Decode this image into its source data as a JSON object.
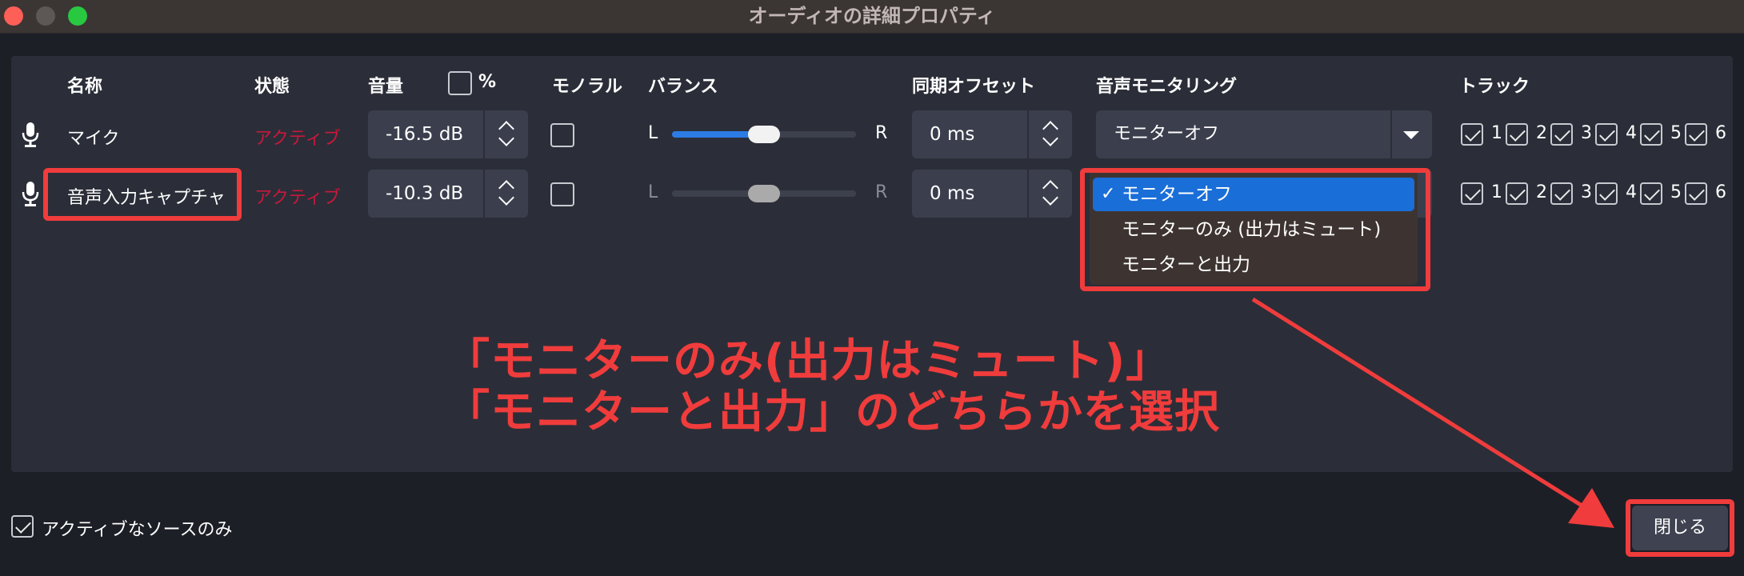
{
  "window": {
    "title": "オーディオの詳細プロパティ"
  },
  "headers": {
    "name": "名称",
    "state": "状態",
    "volume": "音量",
    "percent": "%",
    "mono": "モノラル",
    "balance": "バランス",
    "sync_offset": "同期オフセット",
    "monitoring": "音声モニタリング",
    "tracks": "トラック"
  },
  "rows": [
    {
      "name": "マイク",
      "state": "アクティブ",
      "volume": "-16.5 dB",
      "mono": false,
      "balance": {
        "left": "L",
        "right": "R",
        "value": 0.5
      },
      "offset": "0 ms",
      "monitoring": "モニターオフ",
      "tracks": [
        {
          "label": "1",
          "checked": true
        },
        {
          "label": "2",
          "checked": true
        },
        {
          "label": "3",
          "checked": true
        },
        {
          "label": "4",
          "checked": true
        },
        {
          "label": "5",
          "checked": true
        },
        {
          "label": "6",
          "checked": true
        }
      ]
    },
    {
      "name": "音声入力キャプチャ",
      "state": "アクティブ",
      "volume": "-10.3 dB",
      "mono": false,
      "balance": {
        "left": "L",
        "right": "R",
        "value": 0.5
      },
      "offset": "0 ms",
      "monitoring": "モニターオフ",
      "tracks": [
        {
          "label": "1",
          "checked": true
        },
        {
          "label": "2",
          "checked": true
        },
        {
          "label": "3",
          "checked": true
        },
        {
          "label": "4",
          "checked": true
        },
        {
          "label": "5",
          "checked": true
        },
        {
          "label": "6",
          "checked": true
        }
      ]
    }
  ],
  "dropdown": {
    "options": [
      "モニターオフ",
      "モニターのみ (出力はミュート)",
      "モニターと出力"
    ],
    "selected_index": 0,
    "check_glyph": "✓"
  },
  "annotation": {
    "line1": "「モニターのみ(出力はミュート)」",
    "line2": "「モニターと出力」のどちらかを選択"
  },
  "footer": {
    "active_only_label": "アクティブなソースのみ",
    "active_only_checked": true,
    "close_label": "閉じる"
  },
  "colors": {
    "accent": "#2c7be5",
    "state_active": "#c7183c",
    "annotation_red": "#f03c3c",
    "dropdown_selected": "#1a6ed8"
  }
}
